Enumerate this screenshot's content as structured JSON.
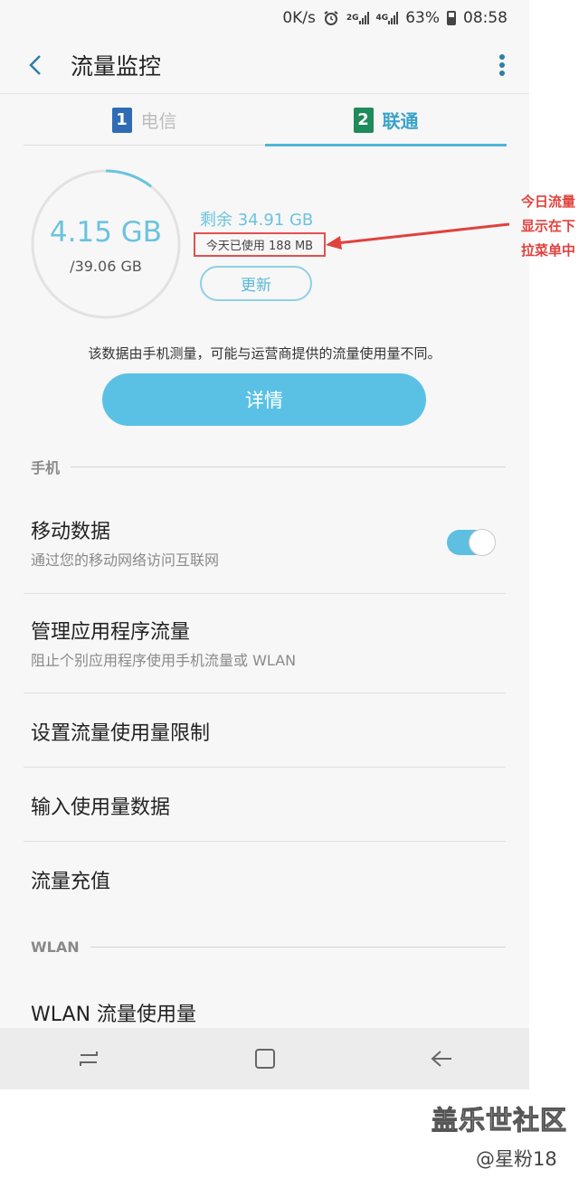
{
  "status_bar": {
    "speed": "0K/s",
    "net_2g": "2G",
    "net_4g": "4G",
    "battery_pct": "63%",
    "time": "08:58"
  },
  "app_bar": {
    "title": "流量监控"
  },
  "tabs": [
    {
      "num": "1",
      "label": "电信",
      "active": false
    },
    {
      "num": "2",
      "label": "联通",
      "active": true
    }
  ],
  "usage": {
    "used": "4.15 GB",
    "total": "/39.06 GB",
    "used_fraction": 0.106,
    "remaining": "剩余 34.91 GB",
    "today_used": "今天已使用 188 MB",
    "refresh_label": "更新"
  },
  "disclaimer": "该数据由手机测量，可能与运营商提供的流量使用量不同。",
  "details_label": "详情",
  "sections": {
    "phone": "手机",
    "wlan": "WLAN"
  },
  "rows": {
    "mobile_data": {
      "title": "移动数据",
      "sub": "通过您的移动网络访问互联网",
      "enabled": true
    },
    "manage_app": {
      "title": "管理应用程序流量",
      "sub": "阻止个别应用程序使用手机流量或 WLAN"
    },
    "set_limit": {
      "title": "设置流量使用量限制"
    },
    "input_usage": {
      "title": "输入使用量数据"
    },
    "recharge": {
      "title": "流量充值"
    },
    "wlan_usage": {
      "title": "WLAN 流量使用量"
    }
  },
  "annotation": {
    "line1": "今日流量",
    "line2": "显示在下",
    "line3": "拉菜单中"
  },
  "watermark": {
    "main": "盖乐世社区",
    "sub": "@星粉18"
  },
  "colors": {
    "accent": "#5bc1e4",
    "annotation": "#e0423e"
  }
}
